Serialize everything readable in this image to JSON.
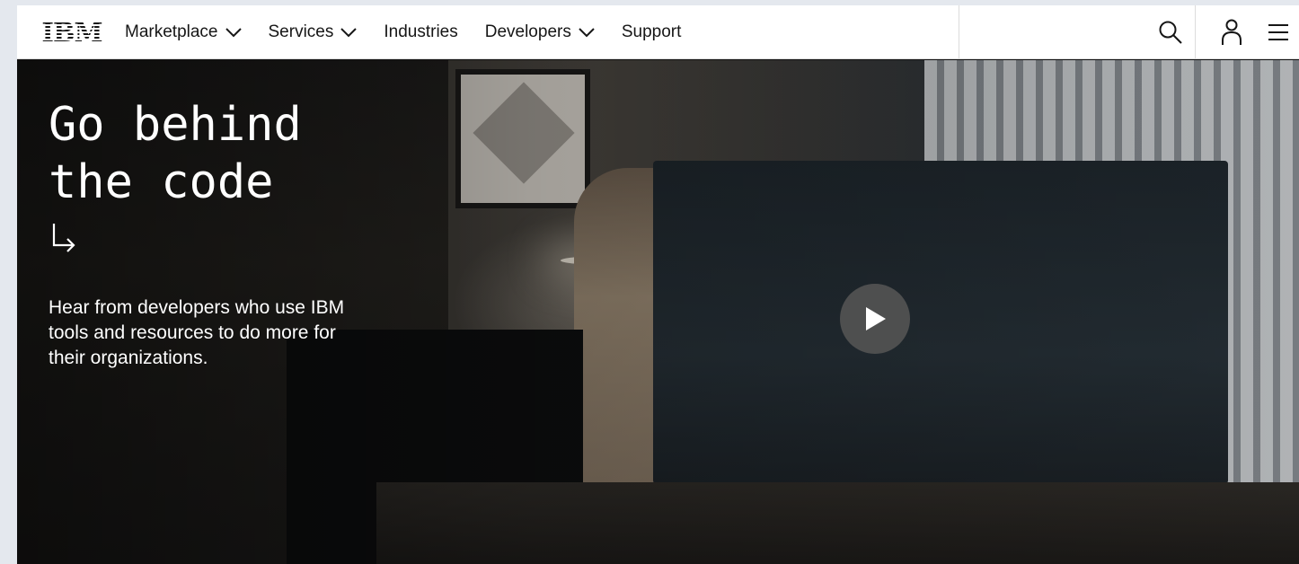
{
  "nav": {
    "logo": "IBM",
    "items": [
      {
        "label": "Marketplace",
        "dropdown": true
      },
      {
        "label": "Services",
        "dropdown": true
      },
      {
        "label": "Industries",
        "dropdown": false
      },
      {
        "label": "Developers",
        "dropdown": true
      },
      {
        "label": "Support",
        "dropdown": false
      }
    ],
    "icons": [
      "search-icon",
      "user-icon",
      "menu-icon"
    ]
  },
  "hero": {
    "headline": "Go behind\nthe code",
    "arrow": "arrow-down-right-icon",
    "description": "Hear from developers who use IBM tools and resources to do more for their organizations.",
    "play": "play-icon"
  },
  "colors": {
    "nav_bg": "#ffffff",
    "text_dark": "#161616",
    "hero_text": "#ffffff",
    "play_bg": "#525252",
    "page_bg": "#e4e8ee"
  }
}
